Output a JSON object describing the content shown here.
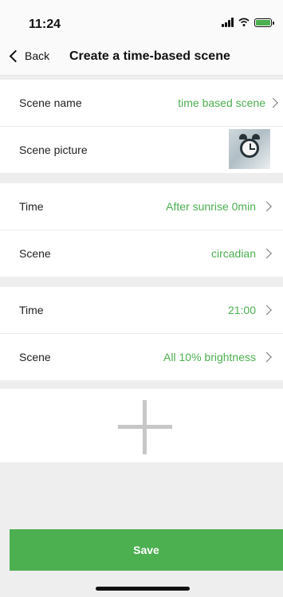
{
  "status_bar": {
    "time": "11:24"
  },
  "nav": {
    "back_label": "Back",
    "title": "Create a time-based scene"
  },
  "scene_info": {
    "name_label": "Scene name",
    "name_value": "time based scene",
    "picture_label": "Scene picture"
  },
  "rules": [
    {
      "time_label": "Time",
      "time_value": "After sunrise 0min",
      "scene_label": "Scene",
      "scene_value": "circadian"
    },
    {
      "time_label": "Time",
      "time_value": "21:00",
      "scene_label": "Scene",
      "scene_value": "All 10% brightness"
    }
  ],
  "save_label": "Save",
  "colors": {
    "accent": "#4caf50",
    "background": "#eeeeee"
  }
}
